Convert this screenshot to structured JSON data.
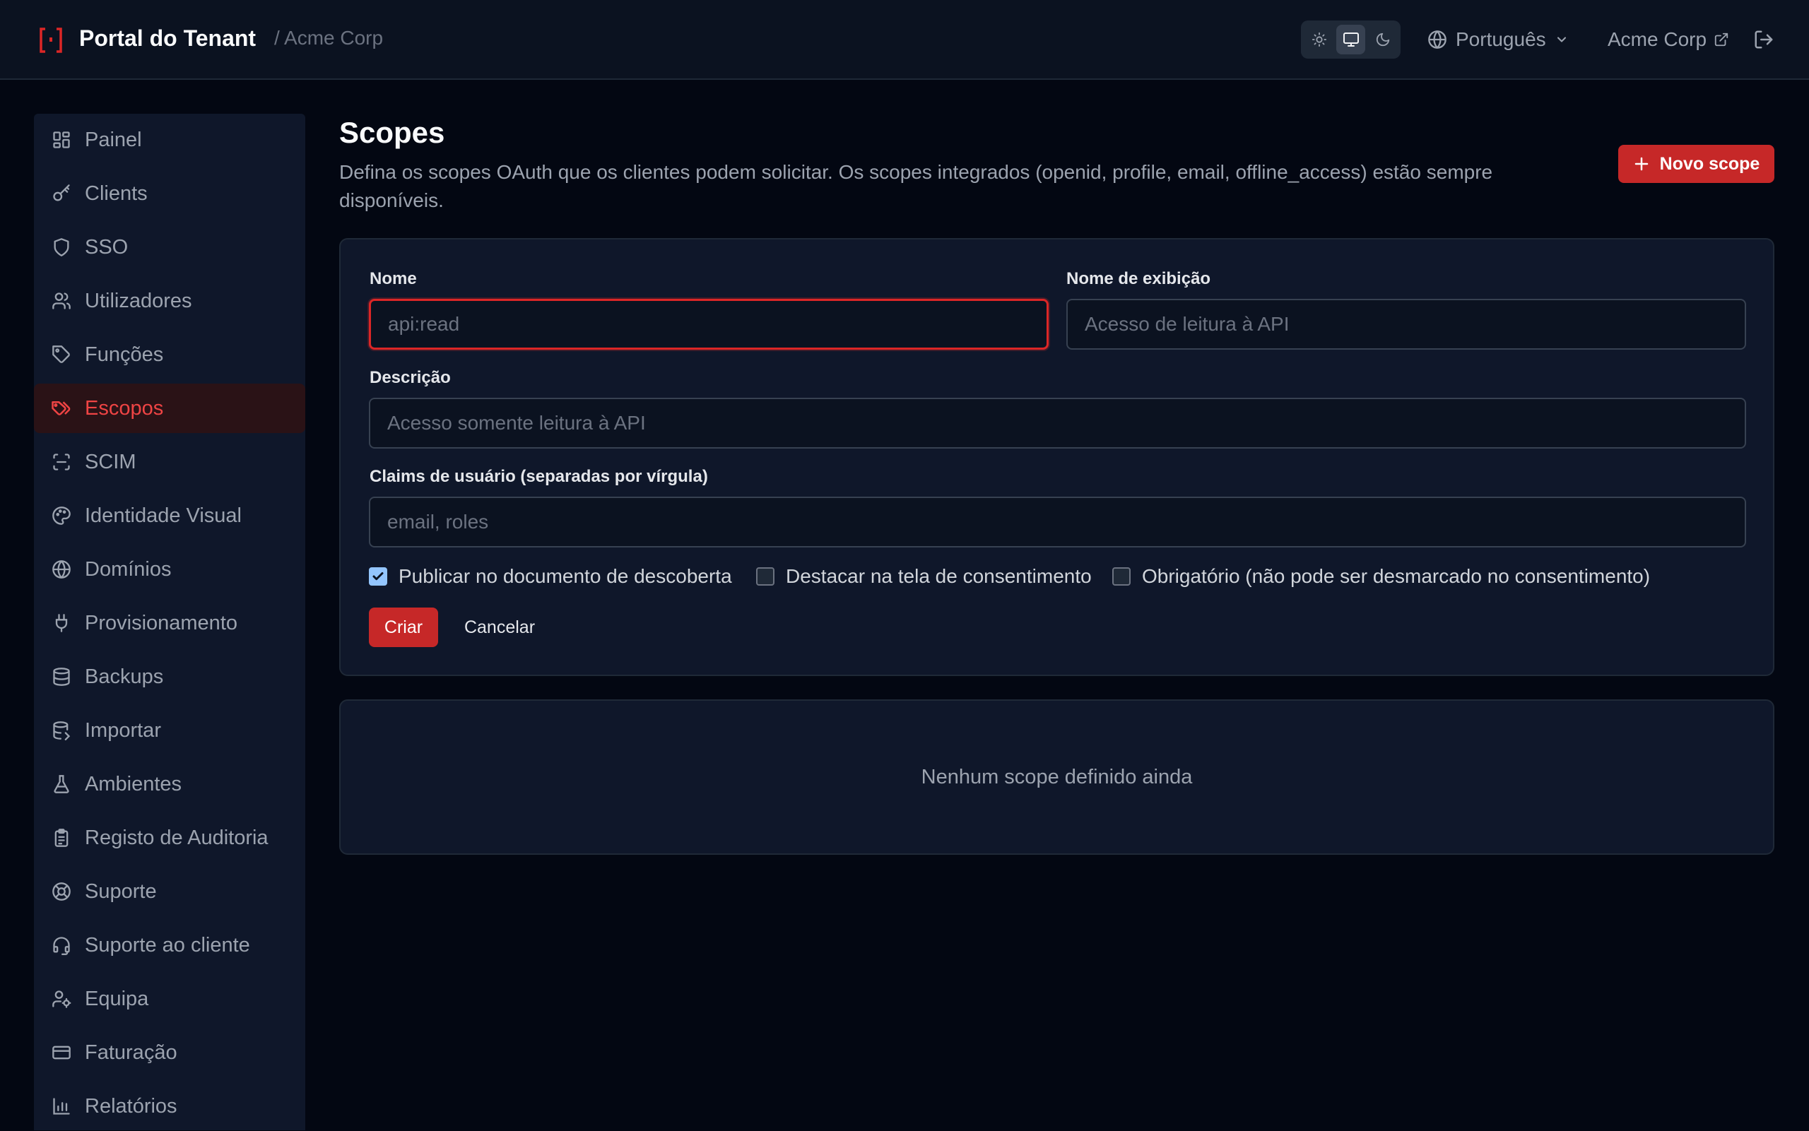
{
  "header": {
    "app_title": "Portal do Tenant",
    "tenant_crumb": "/ Acme Corp",
    "theme_options": [
      "light",
      "system",
      "dark"
    ],
    "theme_selected": "system",
    "language": "Português",
    "org_link": "Acme Corp"
  },
  "sidebar": {
    "items": [
      {
        "label": "Painel",
        "icon": "dashboard-icon"
      },
      {
        "label": "Clients",
        "icon": "key-icon"
      },
      {
        "label": "SSO",
        "icon": "shield-icon"
      },
      {
        "label": "Utilizadores",
        "icon": "users-icon"
      },
      {
        "label": "Funções",
        "icon": "tag-icon"
      },
      {
        "label": "Escopos",
        "icon": "tags-icon",
        "active": true
      },
      {
        "label": "SCIM",
        "icon": "scan-icon"
      },
      {
        "label": "Identidade Visual",
        "icon": "palette-icon"
      },
      {
        "label": "Domínios",
        "icon": "globe-icon"
      },
      {
        "label": "Provisionamento",
        "icon": "plug-icon"
      },
      {
        "label": "Backups",
        "icon": "database-icon"
      },
      {
        "label": "Importar",
        "icon": "database-import-icon"
      },
      {
        "label": "Ambientes",
        "icon": "flask-icon"
      },
      {
        "label": "Registo de Auditoria",
        "icon": "clipboard-icon"
      },
      {
        "label": "Suporte",
        "icon": "lifebuoy-icon"
      },
      {
        "label": "Suporte ao cliente",
        "icon": "headset-icon"
      },
      {
        "label": "Equipa",
        "icon": "user-cog-icon"
      },
      {
        "label": "Faturação",
        "icon": "credit-card-icon"
      },
      {
        "label": "Relatórios",
        "icon": "bar-chart-icon"
      }
    ]
  },
  "main": {
    "title": "Scopes",
    "description": "Defina os scopes OAuth que os clientes podem solicitar. Os scopes integrados (openid, profile, email, offline_access) estão sempre disponíveis.",
    "new_button": "Novo scope",
    "form": {
      "name_label": "Nome",
      "name_placeholder": "api:read",
      "name_value": "",
      "display_label": "Nome de exibição",
      "display_placeholder": "Acesso de leitura à API",
      "display_value": "",
      "description_label": "Descrição",
      "description_placeholder": "Acesso somente leitura à API",
      "description_value": "",
      "claims_label": "Claims de usuário (separadas por vírgula)",
      "claims_placeholder": "email, roles",
      "claims_value": "",
      "checkboxes": [
        {
          "label": "Publicar no documento de descoberta",
          "checked": true
        },
        {
          "label": "Destacar na tela de consentimento",
          "checked": false
        },
        {
          "label": "Obrigatório (não pode ser desmarcado no consentimento)",
          "checked": false
        }
      ],
      "create_button": "Criar",
      "cancel_button": "Cancelar"
    },
    "empty_state": "Nenhum scope definido ainda"
  },
  "colors": {
    "accent": "#c62828",
    "active_text": "#ef4444",
    "background": "#030712",
    "surface": "#0f172a"
  }
}
